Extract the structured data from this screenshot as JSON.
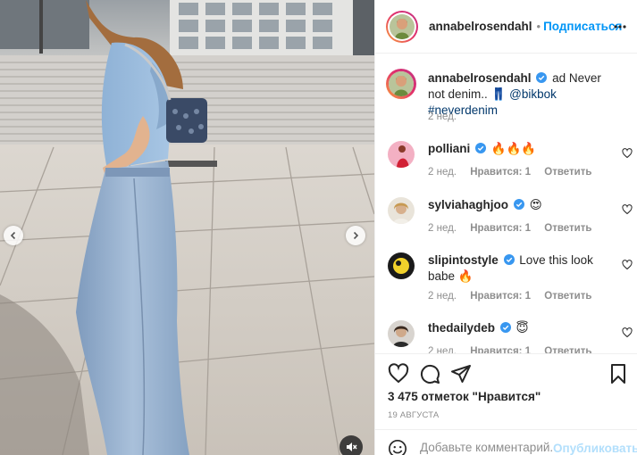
{
  "header": {
    "username": "annabelrosendahl",
    "dot": "•",
    "follow_label": "Подписаться"
  },
  "caption": {
    "username": "annabelrosendahl",
    "text_before": "ad Never not denim..",
    "emoji": "👖",
    "mention": "@bikbok",
    "hashtag": "#neverdenim",
    "time": "2 нед."
  },
  "comments": [
    {
      "username": "polliani",
      "text": "",
      "emoji": "🔥🔥🔥",
      "time": "2 нед.",
      "likes_label": "Нравится: 1",
      "reply_label": "Ответить"
    },
    {
      "username": "sylviahaghjoo",
      "text": "",
      "emoji": "😍",
      "time": "2 нед.",
      "likes_label": "Нравится: 1",
      "reply_label": "Ответить"
    },
    {
      "username": "slipintostyle",
      "text": "Love this look babe",
      "emoji": "🔥",
      "time": "2 нед.",
      "likes_label": "Нравится: 1",
      "reply_label": "Ответить"
    },
    {
      "username": "thedailydeb",
      "text": "",
      "emoji": "😇",
      "time": "2 нед.",
      "likes_label": "Нравится: 1",
      "reply_label": "Ответить"
    }
  ],
  "likes_text": "3 475 отметок \"Нравится\"",
  "date_text": "19 АВГУСТА",
  "comment_box": {
    "placeholder": "Добавьте комментарий...",
    "publish_label": "Опубликовать"
  },
  "colors": {
    "accent": "#0095f6",
    "verified": "#3897f0",
    "text": "#262626",
    "muted": "#8e8e8e"
  },
  "icons": [
    "chevron-left-icon",
    "chevron-right-icon",
    "mute-icon",
    "more-icon",
    "verified-icon",
    "heart-icon",
    "comment-icon",
    "share-icon",
    "bookmark-icon",
    "emoji-icon"
  ]
}
